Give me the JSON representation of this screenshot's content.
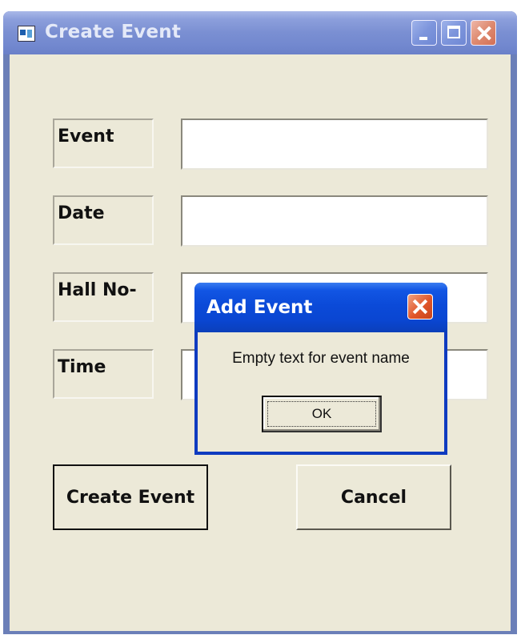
{
  "window": {
    "title": "Create Event",
    "title_icon": "app-window-icon"
  },
  "form": {
    "fields": [
      {
        "label": "Event",
        "value": ""
      },
      {
        "label": "Date",
        "value": ""
      },
      {
        "label": "Hall No-",
        "value": ""
      },
      {
        "label": "Time",
        "value": ""
      }
    ],
    "create_label": "Create Event",
    "cancel_label": "Cancel"
  },
  "dialog": {
    "title": "Add Event",
    "message": "Empty text for event name",
    "ok_label": "OK"
  },
  "colors": {
    "dialog_titlebar": "#0a46d2",
    "window_titlebar_inactive": "#7a8fd2",
    "client_bg": "#ece9d8"
  }
}
